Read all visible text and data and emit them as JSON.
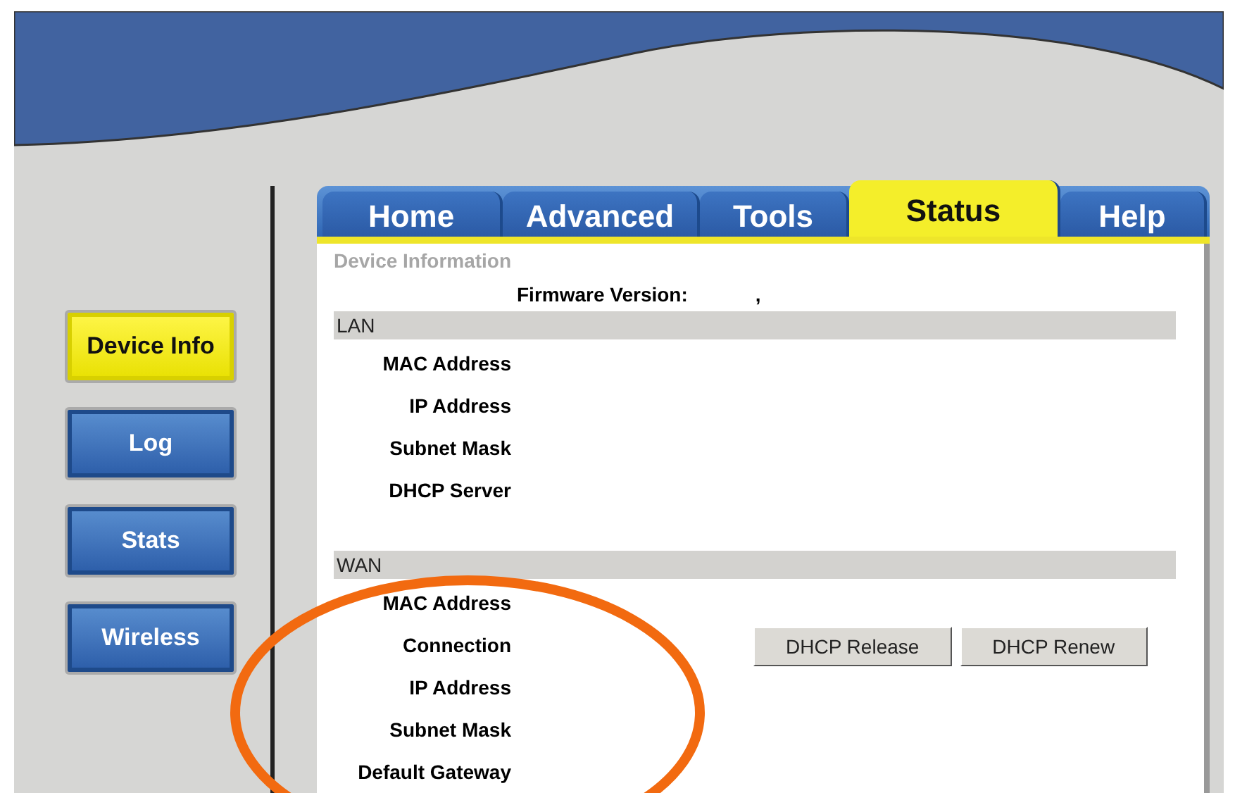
{
  "side_nav": [
    {
      "label": "Device Info",
      "selected": true
    },
    {
      "label": "Log",
      "selected": false
    },
    {
      "label": "Stats",
      "selected": false
    },
    {
      "label": "Wireless",
      "selected": false
    }
  ],
  "tabs": [
    {
      "label": "Home",
      "selected": false
    },
    {
      "label": "Advanced",
      "selected": false
    },
    {
      "label": "Tools",
      "selected": false
    },
    {
      "label": "Status",
      "selected": true
    },
    {
      "label": "Help",
      "selected": false
    }
  ],
  "page_title": "Device Information",
  "firmware": {
    "label": "Firmware Version:",
    "value": ","
  },
  "sections": [
    {
      "title": "LAN",
      "rows": [
        "MAC Address",
        "IP Address",
        "Subnet Mask",
        "DHCP Server"
      ]
    },
    {
      "title": "WAN",
      "rows": [
        "MAC Address",
        "Connection",
        "IP Address",
        "Subnet Mask",
        "Default Gateway"
      ],
      "buttons": [
        "DHCP Release",
        "DHCP Renew"
      ]
    }
  ]
}
